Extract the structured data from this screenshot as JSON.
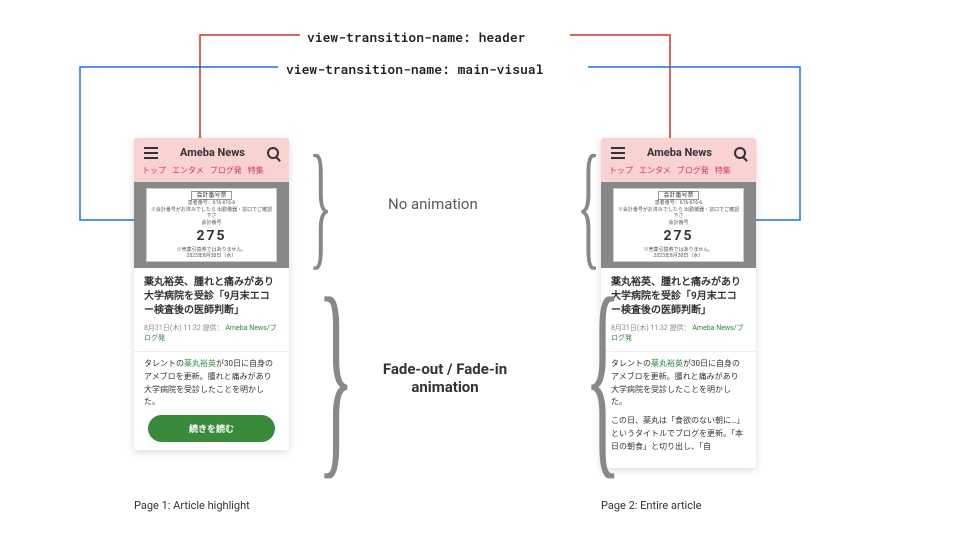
{
  "labels": {
    "header": "view-transition-name: header",
    "mainVisual": "view-transition-name: main-visual",
    "noAnim": "No animation",
    "fadeAnim": "Fade-out / Fade-in animation",
    "caption1": "Page 1: Article highlight",
    "caption2": "Page 2: Entire article"
  },
  "colors": {
    "headerLine": "#d93025",
    "visualLine": "#1a73e8"
  },
  "phone": {
    "brand": "Ameba News",
    "nav": [
      "トップ",
      "エンタメ",
      "ブログ発",
      "特集"
    ],
    "ticket": {
      "title": "会計番号票",
      "line1": "患者番号：616-616-6",
      "line2": "※会計番号がお済みでしたら\n出勤機器・窓口でご確認下さ",
      "numLabel": "会計番号",
      "num": "275",
      "note": "※売薬引換券ではありません。",
      "date": "2023年8月30日（水）"
    },
    "articleTitle": "薬丸裕英、腫れと痛みがあり大学病院を受診「9月末エコー検査後の医師判断」",
    "meta": {
      "time": "8月31日(木) 11:32",
      "provider": "提供：",
      "source": "Ameba News/ブログ発"
    },
    "para1": {
      "pre": "タレントの",
      "link": "薬丸裕英",
      "post": "が30日に自身のアメブロを更新。腫れと痛みがあり大学病院を受診したことを明かした。"
    },
    "para2": "この日、薬丸は「食欲のない朝に…」というタイトルでブログを更新。「本日の朝食」と切り出し、「自",
    "cta": "続きを読む"
  }
}
